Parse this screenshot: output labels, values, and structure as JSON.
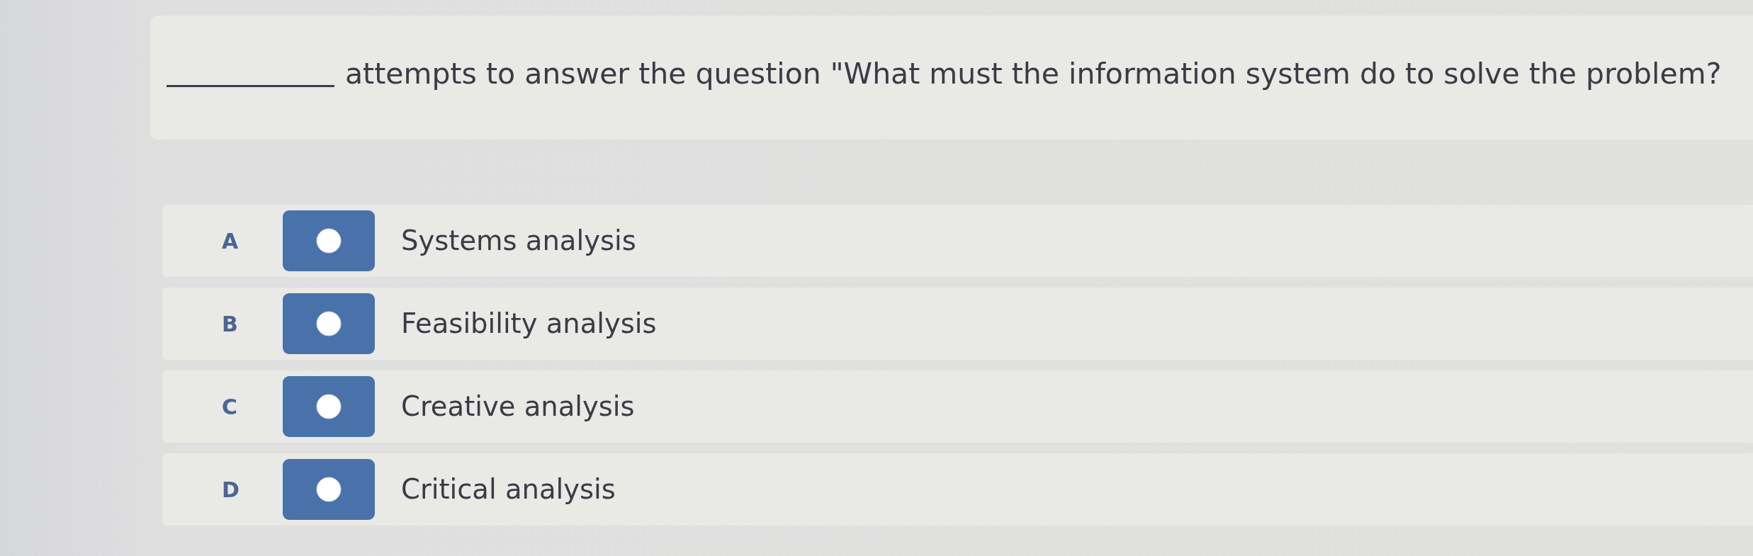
{
  "question": {
    "text": "attempts to answer the question \"What must the information system do to solve the problem?"
  },
  "options": [
    {
      "letter": "A",
      "text": "Systems analysis",
      "selected": false
    },
    {
      "letter": "B",
      "text": "Feasibility analysis",
      "selected": false
    },
    {
      "letter": "C",
      "text": "Creative analysis",
      "selected": false
    },
    {
      "letter": "D",
      "text": "Critical analysis",
      "selected": false
    }
  ]
}
